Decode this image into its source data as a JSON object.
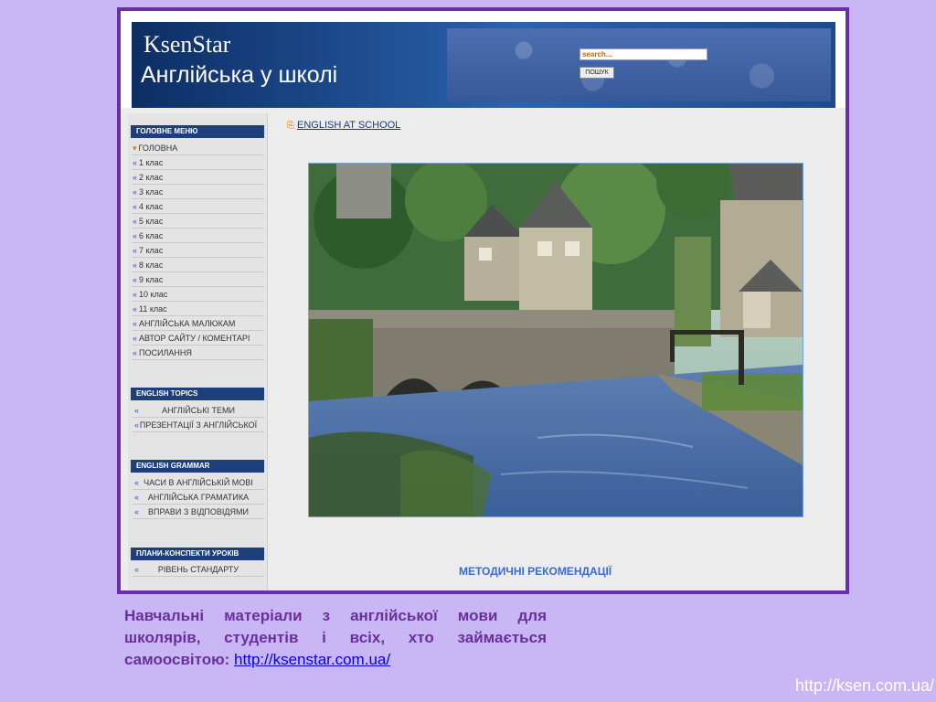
{
  "header": {
    "logo": "KsenStar",
    "subtitle": "Англійська у школі",
    "search_placeholder": "search...",
    "search_button": "ПОШУК"
  },
  "breadcrumb": {
    "link": "ENGLISH AT SCHOOL"
  },
  "main_menu": {
    "title": "ГОЛОВНЕ МЕНЮ",
    "items": [
      "ГОЛОВНА",
      "1 клас",
      "2 клас",
      "3 клас",
      "4 клас",
      "5 клас",
      "6 клас",
      "7 клас",
      "8 клас",
      "9 клас",
      "10 клас",
      "11 клас",
      "АНГЛІЙСЬКА МАЛЮКАМ",
      "АВТОР САЙТУ / КОМЕНТАРІ",
      "ПОСИЛАННЯ"
    ]
  },
  "topics_menu": {
    "title": "ENGLISH TOPICS",
    "items": [
      "АНГЛІЙСЬКІ ТЕМИ",
      "ПРЕЗЕНТАЦІЇ З АНГЛІЙСЬКОЇ"
    ]
  },
  "grammar_menu": {
    "title": "ENGLISH GRAMMAR",
    "items": [
      "ЧАСИ В АНГЛІЙСЬКІЙ МОВІ",
      "АНГЛІЙСЬКА ГРАМАТИКА",
      "ВПРАВИ З ВІДПОВІДЯМИ"
    ]
  },
  "plans_menu": {
    "title": "ПЛАНИ-КОНСПЕКТИ УРОКІВ",
    "items": [
      "РІВЕНЬ СТАНДАРТУ"
    ]
  },
  "main": {
    "section_title": "МЕТОДИЧНІ РЕКОМЕНДАЦІЇ"
  },
  "caption": {
    "text": "Навчальні матеріали з англійської мови для школярів, студентів і всіх, хто займається самоосвітою:",
    "link": "http://ksenstar.com.ua/"
  },
  "footer": {
    "url": "http://ksen.com.ua/"
  },
  "colors": {
    "background": "#c9b6f5",
    "frame": "#6a2fa6",
    "menu_header": "#1e3e7c",
    "caption": "#6a2f9c",
    "link": "#0000ee"
  },
  "icons": {
    "bullet": "double-chevron-left-icon",
    "active_bullet": "chevron-down-icon",
    "breadcrumb": "document-icon"
  }
}
